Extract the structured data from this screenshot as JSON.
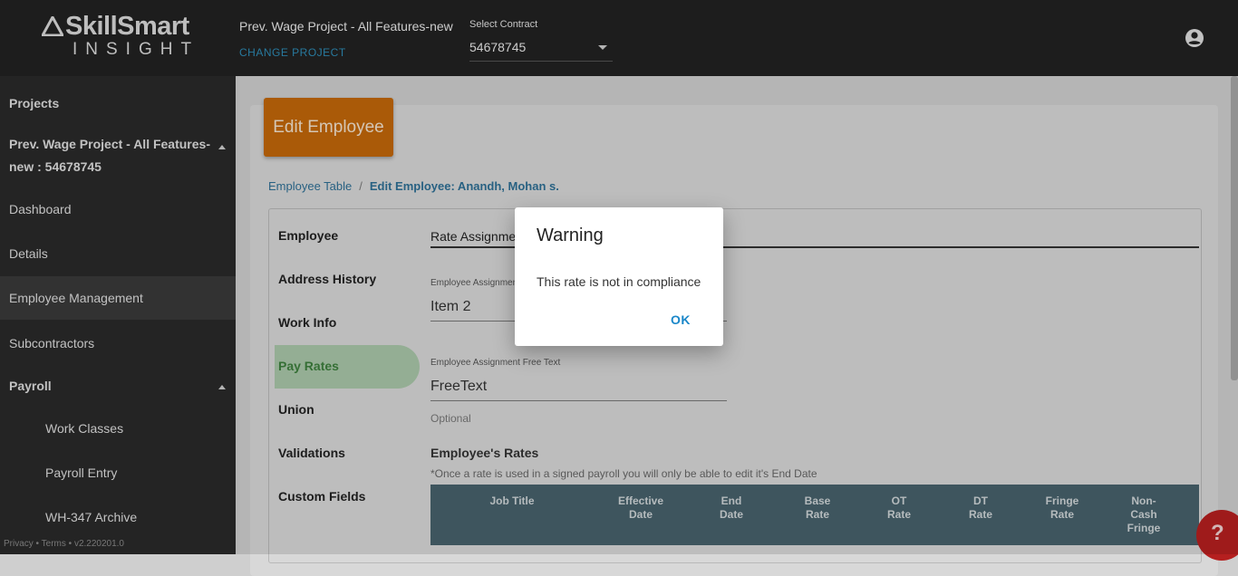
{
  "header": {
    "logo_brand": "SkillSmart",
    "logo_sub": "INSIGHT",
    "project_title": "Prev. Wage Project - All Features-new",
    "change_project": "CHANGE PROJECT",
    "contract_label": "Select Contract",
    "contract_value": "54678745"
  },
  "sidebar": {
    "projects": "Projects",
    "current_project_line1": "Prev. Wage Project - All Features-",
    "current_project_line2": "new : 54678745",
    "dashboard": "Dashboard",
    "details": "Details",
    "employee_management": "Employee Management",
    "subcontractors": "Subcontractors",
    "payroll": "Payroll",
    "work_classes": "Work Classes",
    "payroll_entry": "Payroll Entry",
    "wh347_archive": "WH-347 Archive",
    "footer": "Privacy • Terms • v2.220201.0"
  },
  "main": {
    "card_title": "Edit Employee",
    "breadcrumb_link": "Employee Table",
    "breadcrumb_sep": "/",
    "breadcrumb_current": "Edit Employee: Anandh, Mohan s.",
    "vtabs": [
      "Employee",
      "Address History",
      "Work Info",
      "Pay Rates",
      "Union",
      "Validations",
      "Custom Fields"
    ],
    "rate_tab": "Rate Assignment",
    "assignment_label": "Employee Assignment",
    "assignment_value": "Item 2",
    "free_text_label": "Employee Assignment Free Text",
    "free_text_value": "FreeText",
    "optional": "Optional",
    "rates_title": "Employee's Rates",
    "rates_note": "*Once a rate is used in a signed payroll you will only be able to edit it's End Date",
    "columns": [
      [
        "Job Title"
      ],
      [
        "Effective",
        "Date"
      ],
      [
        "End",
        "Date"
      ],
      [
        "Base",
        "Rate"
      ],
      [
        "OT",
        "Rate"
      ],
      [
        "DT",
        "Rate"
      ],
      [
        "Fringe",
        "Rate"
      ],
      [
        "Non-",
        "Cash",
        "Fringe"
      ]
    ]
  },
  "dialog": {
    "title": "Warning",
    "message": "This rate is not in compliance",
    "ok": "OK"
  },
  "help": "?",
  "colors": {
    "topbar": "#212121",
    "sidebar": "#2a2a2a",
    "header_orange": "#c2670a",
    "table_header": "#47616b",
    "active_tab": "#a9c7a9",
    "link": "#2e8bb5",
    "help_red": "#b51f1f"
  }
}
